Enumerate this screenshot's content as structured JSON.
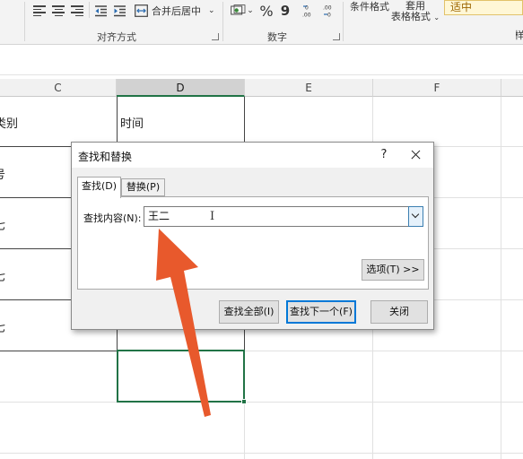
{
  "ribbon": {
    "merge_center": "合并后居中",
    "percent_symbol": "%",
    "comma_symbol": "9",
    "conditional_format": "条件格式",
    "format_as_table_line1": "套用",
    "format_as_table_line2": "表格格式",
    "style_neutral": "适中",
    "groups": {
      "alignment": "对齐方式",
      "number": "数字"
    },
    "edge_letter": "样"
  },
  "columns": [
    "C",
    "D",
    "E",
    "F"
  ],
  "cells": {
    "c_header_partial": "类别",
    "d_header": "时间",
    "row2_partial": "号",
    "row3_partial": "七",
    "row4_partial": "七",
    "row5_partial": "七"
  },
  "dialog": {
    "title": "查找和替换",
    "help": "?",
    "tabs": [
      {
        "label": "查找(D)",
        "active": true
      },
      {
        "label": "替换(P)",
        "active": false
      }
    ],
    "find_label": "查找内容(N):",
    "find_value": "王二",
    "options_label": "选项(T) >>",
    "find_all": "查找全部(I)",
    "find_next": "查找下一个(F)",
    "close": "关闭"
  },
  "colors": {
    "accent_green": "#217346",
    "annotation_arrow": "#e8592c",
    "focus_blue": "#0078d7"
  }
}
